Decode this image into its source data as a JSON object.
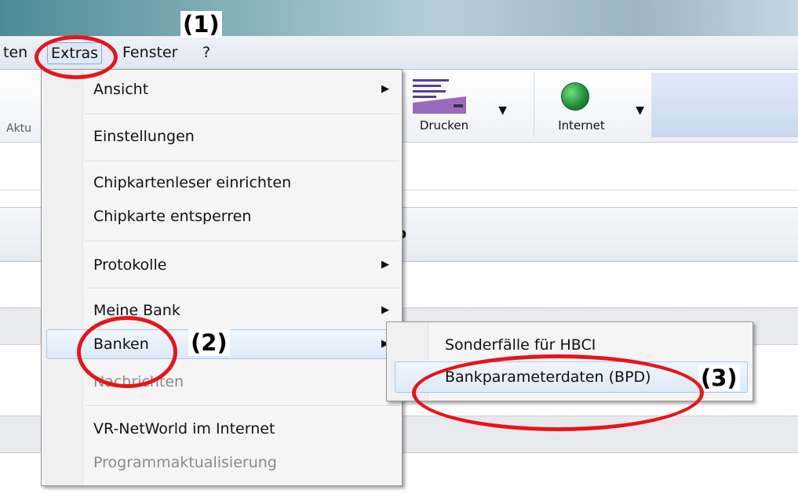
{
  "menubar": {
    "items": [
      {
        "label": "ten"
      },
      {
        "label": "Extras"
      },
      {
        "label": "Fenster"
      },
      {
        "label": "?"
      }
    ]
  },
  "toolbar": {
    "left_label": "Aktu",
    "buttons": [
      {
        "label": "Drucken",
        "icon": "printer-icon"
      },
      {
        "label": "Internet",
        "icon": "globe-icon"
      }
    ]
  },
  "content": {
    "column_header": "o"
  },
  "extras_menu": {
    "items": [
      {
        "label": "Ansicht",
        "submenu": true
      },
      {
        "label": "Einstellungen"
      },
      {
        "label": "Chipkartenleser einrichten"
      },
      {
        "label": "Chipkarte entsperren"
      },
      {
        "label": "Protokolle",
        "submenu": true
      },
      {
        "label": "Meine Bank",
        "submenu": true
      },
      {
        "label": "Banken",
        "submenu": true,
        "highlighted": true
      },
      {
        "label": "Nachrichten",
        "disabled": true
      },
      {
        "label": "VR-NetWorld im Internet"
      },
      {
        "label": "Programmaktualisierung",
        "disabled": true
      }
    ]
  },
  "banken_submenu": {
    "items": [
      {
        "label": "Sonderfälle für HBCI"
      },
      {
        "label": "Bankparameterdaten (BPD)",
        "highlighted": true
      }
    ]
  },
  "annotations": {
    "step1": "(1)",
    "step2": "(2)",
    "step3": "(3)",
    "color": "#e8141c"
  }
}
